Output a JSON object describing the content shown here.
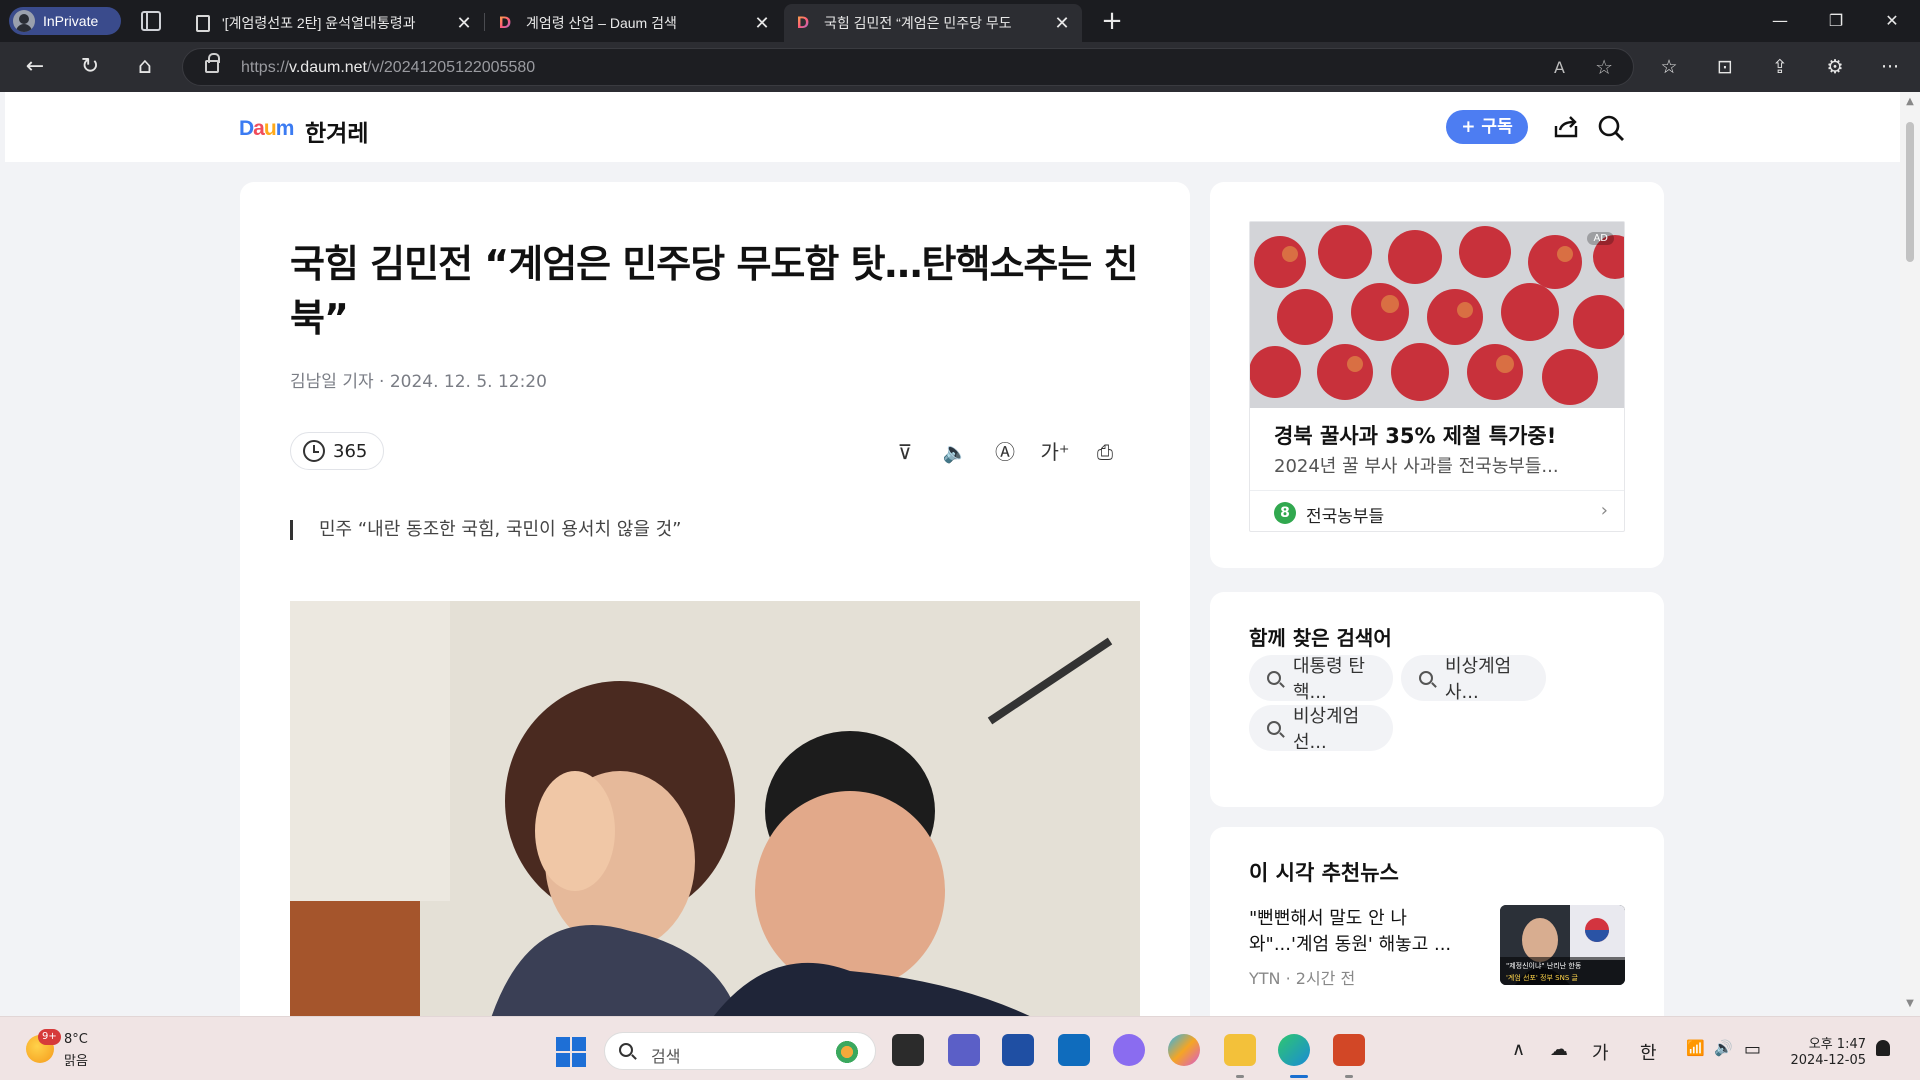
{
  "browser": {
    "inprivate_label": "InPrivate",
    "tabs": [
      {
        "title": "'[계엄령선포 2탄] 윤석열대통령과",
        "close": "✕"
      },
      {
        "title": "계엄령 산업 – Daum 검색",
        "close": "✕"
      },
      {
        "title": "국힘 김민전 “계엄은 민주당 무도",
        "close": "✕"
      }
    ],
    "new_tab": "+",
    "window_controls": {
      "minimize": "—",
      "restore": "❐",
      "close": "✕"
    },
    "url_prefix": "https://",
    "url_host": "v.daum.net",
    "url_path": "/v/20241205122005580",
    "read_aloud": "A",
    "favorite": "☆",
    "toolbar_icons": [
      "favorites-icon",
      "screenshot-icon",
      "share-icon",
      "extensions-icon",
      "more-icon"
    ],
    "more": "···"
  },
  "site": {
    "logo": {
      "d": "D",
      "a": "a",
      "u": "u",
      "m": "m"
    },
    "press": "한겨레",
    "subscribe": "+ 구독"
  },
  "article": {
    "title": "국힘 김민전 “계엄은 민주당 무도함 탓…탄핵소추는 친북”",
    "byline": "김남일 기자 · 2024. 12. 5. 12:20",
    "comments": "365",
    "tools": {
      "summary": "⊽",
      "listen": "🔈",
      "translate": "Ⓐ",
      "fontsize": "가⁺",
      "print": "⎙"
    },
    "subhead": "민주 “내란 동조한 국힘, 국민이 용서치 않을 것”"
  },
  "ad": {
    "badge": "AD",
    "title": "경북 꿀사과 35% 제철 특가중!",
    "desc": "2024년 꿀 부사 사과를 전국농부들...",
    "advertiser": "전국농부들",
    "advertiser_logo": "8",
    "chevron": "›"
  },
  "keywords": {
    "title": "함께 찾은 검색어",
    "items": [
      "대통령 탄핵...",
      "비상계엄 사...",
      "비상계엄 선..."
    ]
  },
  "recommended": {
    "title": "이 시각 추천뉴스",
    "items": [
      {
        "title": "\"뻔뻔해서 말도 안 나와\"...'계엄 동원' 해놓고 ...",
        "source": "YTN",
        "time": "2시간 전",
        "meta": "YTN · 2시간 전",
        "thumb_caption": "\"제정신이냐\" 난리난 한동",
        "thumb_caption2": "'계엄 선포' 정부 SNS 글"
      }
    ]
  },
  "taskbar": {
    "weather_badge": "9+",
    "temp": "8°C",
    "condition": "맑음",
    "search_placeholder": "검색",
    "tray": {
      "chevron": "∧",
      "cloud": "☁",
      "ime1": "가",
      "ime2": "한",
      "wifi": "📶",
      "volume": "🔊",
      "battery": "▭"
    },
    "time": "오후 1:47",
    "date": "2024-12-05"
  }
}
